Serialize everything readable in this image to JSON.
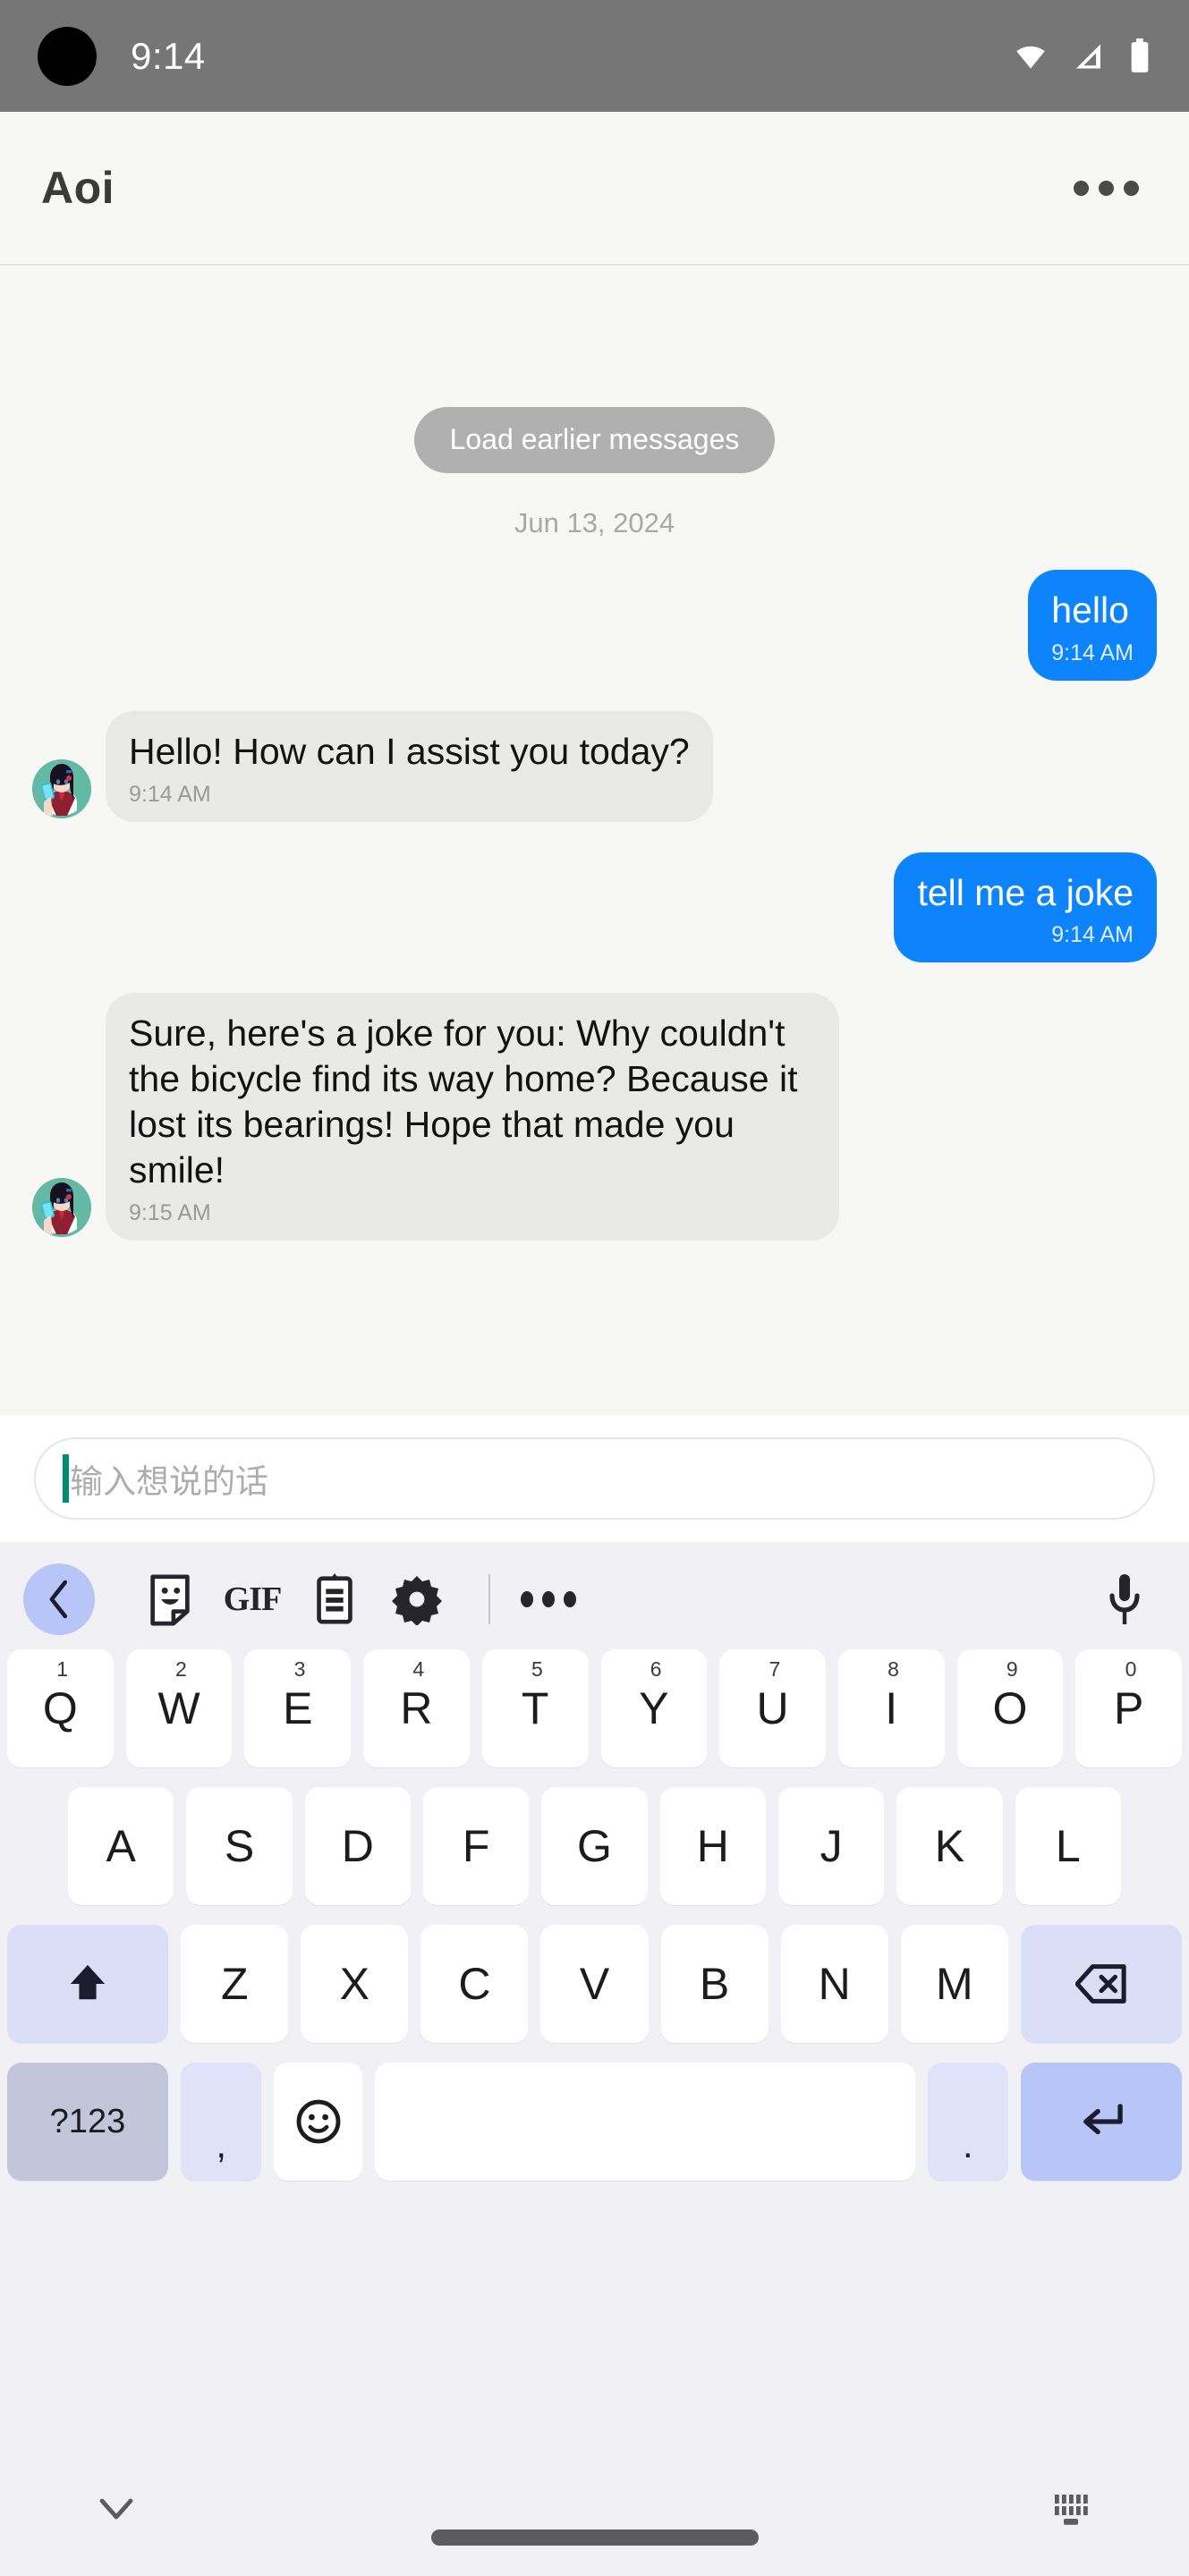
{
  "status_bar": {
    "time": "9:14",
    "icons": [
      "camera-punch-hole",
      "wifi-icon",
      "cellular-signal-icon",
      "battery-icon"
    ]
  },
  "app_bar": {
    "title": "Aoi",
    "menu_icon": "overflow-menu-icon"
  },
  "chat": {
    "load_earlier_label": "Load earlier messages",
    "date_separator": "Jun 13, 2024",
    "messages": [
      {
        "side": "out",
        "text": "hello",
        "time": "9:14 AM",
        "avatar": false
      },
      {
        "side": "in",
        "text": "Hello! How can I assist you today?",
        "time": "9:14 AM",
        "avatar": true
      },
      {
        "side": "out",
        "text": "tell me a joke",
        "time": "9:14 AM",
        "avatar": false
      },
      {
        "side": "in",
        "text": "Sure, here's a joke for you: Why couldn't the bicycle find its way home? Because it lost its bearings! Hope that made you smile!",
        "time": "9:15 AM",
        "avatar": true
      }
    ]
  },
  "composer": {
    "placeholder": "输入想说的话",
    "value": "",
    "caret_color": "#008b73"
  },
  "keyboard": {
    "toolbar": [
      {
        "name": "back-chevron-icon",
        "label": ""
      },
      {
        "name": "sticker-icon",
        "label": ""
      },
      {
        "name": "gif-icon",
        "label": "GIF"
      },
      {
        "name": "clipboard-icon",
        "label": ""
      },
      {
        "name": "settings-gear-icon",
        "label": ""
      },
      {
        "name": "more-options-icon",
        "label": ""
      },
      {
        "name": "microphone-icon",
        "label": ""
      }
    ],
    "row1": [
      {
        "label": "Q",
        "sup": "1"
      },
      {
        "label": "W",
        "sup": "2"
      },
      {
        "label": "E",
        "sup": "3"
      },
      {
        "label": "R",
        "sup": "4"
      },
      {
        "label": "T",
        "sup": "5"
      },
      {
        "label": "Y",
        "sup": "6"
      },
      {
        "label": "U",
        "sup": "7"
      },
      {
        "label": "I",
        "sup": "8"
      },
      {
        "label": "O",
        "sup": "9"
      },
      {
        "label": "P",
        "sup": "0"
      }
    ],
    "row2": [
      {
        "label": "A"
      },
      {
        "label": "S"
      },
      {
        "label": "D"
      },
      {
        "label": "F"
      },
      {
        "label": "G"
      },
      {
        "label": "H"
      },
      {
        "label": "J"
      },
      {
        "label": "K"
      },
      {
        "label": "L"
      }
    ],
    "row3": [
      {
        "label": "Z"
      },
      {
        "label": "X"
      },
      {
        "label": "C"
      },
      {
        "label": "V"
      },
      {
        "label": "B"
      },
      {
        "label": "N"
      },
      {
        "label": "M"
      }
    ],
    "shift_label": "",
    "backspace_label": "",
    "symbols_label": "?123",
    "comma_label": ",",
    "emoji_label": "",
    "space_label": "",
    "period_label": ".",
    "enter_label": ""
  },
  "nav_bar": {
    "dismiss_icon": "chevron-down-icon",
    "home_indicator": "home-indicator",
    "switch_keyboard_icon": "keyboard-switch-icon"
  },
  "colors": {
    "accent_blue": "#0d84fb",
    "status_bar": "#767676",
    "incoming_bubble": "#e9e9e8",
    "keyboard_bg": "#f1f0f5",
    "key_mod": "#dadef7",
    "enter_key": "#b7c6f7"
  }
}
